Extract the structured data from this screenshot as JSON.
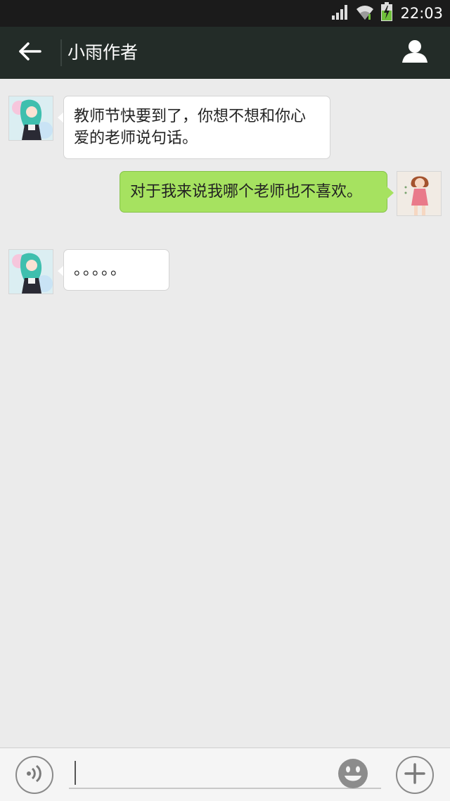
{
  "status_bar": {
    "time": "22:03",
    "icons": [
      "signal-icon",
      "wifi-icon",
      "battery-charging-icon"
    ]
  },
  "header": {
    "title": "小雨作者",
    "back_icon": "arrow-left-icon",
    "profile_icon": "person-icon"
  },
  "messages": [
    {
      "side": "left",
      "text": "教师节快要到了，你想不想和你心爱的老师说句话。"
    },
    {
      "side": "right",
      "text": "对于我来说我哪个老师也不喜欢。"
    },
    {
      "side": "left",
      "text": "。。。。。"
    }
  ],
  "input_bar": {
    "voice_icon": "voice-icon",
    "emoji_icon": "emoji-icon",
    "plus_icon": "plus-icon",
    "input_value": ""
  },
  "colors": {
    "header_bg": "#232c28",
    "status_bg": "#1b1b1b",
    "chat_bg": "#ebebeb",
    "bubble_self": "#a6e260",
    "bubble_other": "#ffffff"
  }
}
